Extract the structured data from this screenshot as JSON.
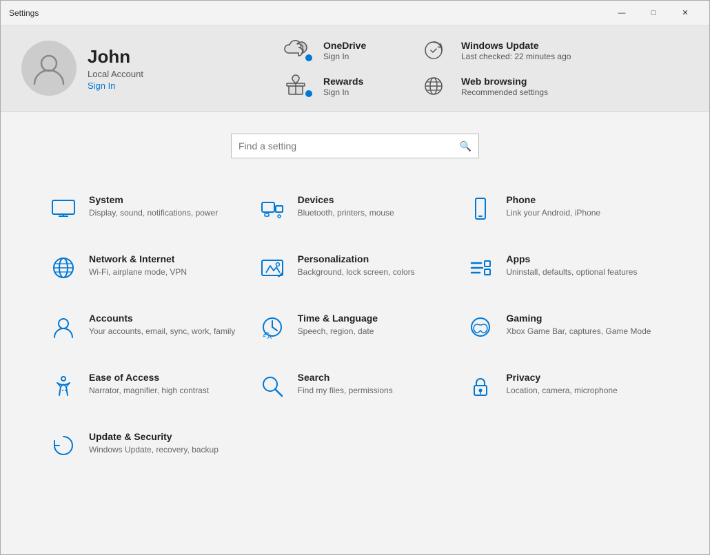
{
  "titlebar": {
    "title": "Settings",
    "minimize": "—",
    "maximize": "□",
    "close": "✕"
  },
  "profile": {
    "name": "John",
    "account_type": "Local Account",
    "signin_label": "Sign In"
  },
  "services": [
    {
      "id": "onedrive",
      "name": "OneDrive",
      "desc": "Sign In",
      "has_badge": true
    },
    {
      "id": "rewards",
      "name": "Rewards",
      "desc": "Sign In",
      "has_badge": true
    },
    {
      "id": "windows-update",
      "name": "Windows Update",
      "desc": "Last checked: 22 minutes ago",
      "has_badge": false
    },
    {
      "id": "web-browsing",
      "name": "Web browsing",
      "desc": "Recommended settings",
      "has_badge": false
    }
  ],
  "search": {
    "placeholder": "Find a setting"
  },
  "settings": [
    {
      "id": "system",
      "name": "System",
      "desc": "Display, sound, notifications, power"
    },
    {
      "id": "devices",
      "name": "Devices",
      "desc": "Bluetooth, printers, mouse"
    },
    {
      "id": "phone",
      "name": "Phone",
      "desc": "Link your Android, iPhone"
    },
    {
      "id": "network",
      "name": "Network & Internet",
      "desc": "Wi-Fi, airplane mode, VPN"
    },
    {
      "id": "personalization",
      "name": "Personalization",
      "desc": "Background, lock screen, colors"
    },
    {
      "id": "apps",
      "name": "Apps",
      "desc": "Uninstall, defaults, optional features"
    },
    {
      "id": "accounts",
      "name": "Accounts",
      "desc": "Your accounts, email, sync, work, family"
    },
    {
      "id": "time-language",
      "name": "Time & Language",
      "desc": "Speech, region, date"
    },
    {
      "id": "gaming",
      "name": "Gaming",
      "desc": "Xbox Game Bar, captures, Game Mode"
    },
    {
      "id": "ease-of-access",
      "name": "Ease of Access",
      "desc": "Narrator, magnifier, high contrast"
    },
    {
      "id": "search",
      "name": "Search",
      "desc": "Find my files, permissions"
    },
    {
      "id": "privacy",
      "name": "Privacy",
      "desc": "Location, camera, microphone"
    },
    {
      "id": "update-security",
      "name": "Update & Security",
      "desc": "Windows Update, recovery, backup"
    }
  ],
  "colors": {
    "accent": "#0078d4",
    "header_bg": "#e8e8e8",
    "body_bg": "#f3f3f3"
  }
}
